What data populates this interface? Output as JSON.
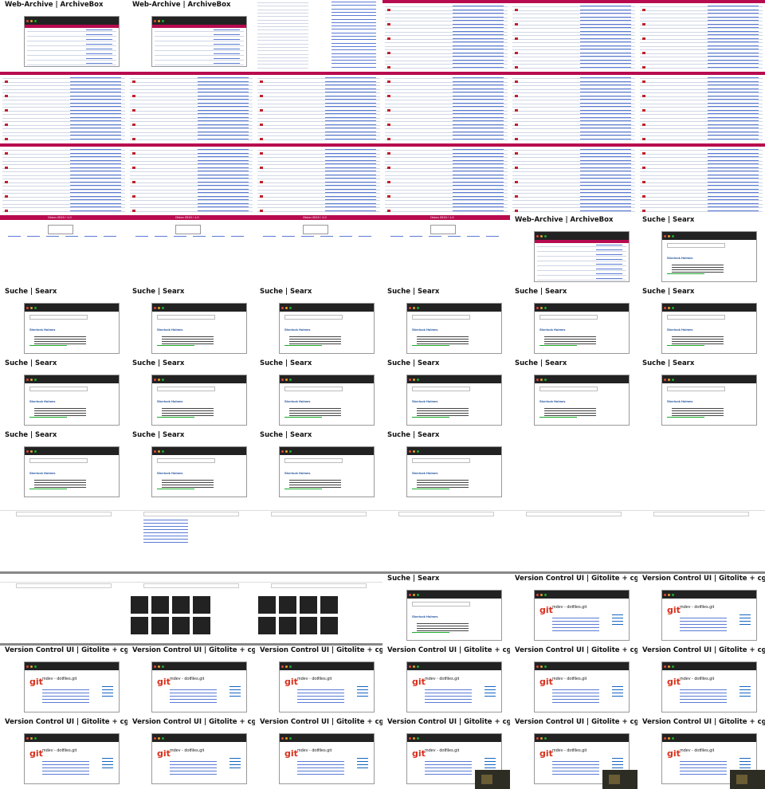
{
  "titles": {
    "archive": "Web-Archive | ArchiveBox",
    "searx": "Suche | Searx",
    "git": "Version Control UI | Gitolite + cgit"
  },
  "widgets": {
    "tor_header": "Onion 2019 / 1.0",
    "searx_heading": "Sherlock Holmes",
    "git_repo": "mdev - dotfiles.git",
    "git_logo": "git"
  },
  "tiles": [
    {
      "r": 0,
      "c": 0,
      "kind": "archive-win",
      "title": "archive"
    },
    {
      "r": 0,
      "c": 1,
      "kind": "archive-win",
      "title": "archive"
    },
    {
      "r": 0,
      "c": 2,
      "kind": "list"
    },
    {
      "r": 0,
      "c": 3,
      "kind": "table-header"
    },
    {
      "r": 0,
      "c": 4,
      "kind": "table-header"
    },
    {
      "r": 0,
      "c": 5,
      "kind": "table-header"
    },
    {
      "r": 1,
      "c": 0,
      "kind": "table-header"
    },
    {
      "r": 1,
      "c": 1,
      "kind": "table-header"
    },
    {
      "r": 1,
      "c": 2,
      "kind": "table-header"
    },
    {
      "r": 1,
      "c": 3,
      "kind": "table-header"
    },
    {
      "r": 1,
      "c": 4,
      "kind": "table-header"
    },
    {
      "r": 1,
      "c": 5,
      "kind": "table-header"
    },
    {
      "r": 2,
      "c": 0,
      "kind": "table-header"
    },
    {
      "r": 2,
      "c": 1,
      "kind": "table-header"
    },
    {
      "r": 2,
      "c": 2,
      "kind": "table-header"
    },
    {
      "r": 2,
      "c": 3,
      "kind": "table-header"
    },
    {
      "r": 2,
      "c": 4,
      "kind": "table-header"
    },
    {
      "r": 2,
      "c": 5,
      "kind": "table-header"
    },
    {
      "r": 3,
      "c": 0,
      "kind": "tor"
    },
    {
      "r": 3,
      "c": 1,
      "kind": "tor"
    },
    {
      "r": 3,
      "c": 2,
      "kind": "tor"
    },
    {
      "r": 3,
      "c": 3,
      "kind": "tor"
    },
    {
      "r": 3,
      "c": 4,
      "kind": "archive-win",
      "title": "archive"
    },
    {
      "r": 3,
      "c": 5,
      "kind": "searx-win",
      "title": "searx"
    },
    {
      "r": 4,
      "c": 0,
      "kind": "searx-win",
      "title": "searx"
    },
    {
      "r": 4,
      "c": 1,
      "kind": "searx-win",
      "title": "searx"
    },
    {
      "r": 4,
      "c": 2,
      "kind": "searx-win",
      "title": "searx"
    },
    {
      "r": 4,
      "c": 3,
      "kind": "searx-win",
      "title": "searx"
    },
    {
      "r": 4,
      "c": 4,
      "kind": "searx-win",
      "title": "searx"
    },
    {
      "r": 4,
      "c": 5,
      "kind": "searx-win",
      "title": "searx"
    },
    {
      "r": 5,
      "c": 0,
      "kind": "searx-win",
      "title": "searx"
    },
    {
      "r": 5,
      "c": 1,
      "kind": "searx-win",
      "title": "searx"
    },
    {
      "r": 5,
      "c": 2,
      "kind": "searx-win",
      "title": "searx"
    },
    {
      "r": 5,
      "c": 3,
      "kind": "searx-win",
      "title": "searx"
    },
    {
      "r": 5,
      "c": 4,
      "kind": "searx-win",
      "title": "searx"
    },
    {
      "r": 5,
      "c": 5,
      "kind": "searx-win",
      "title": "searx"
    },
    {
      "r": 6,
      "c": 0,
      "kind": "searx-win",
      "title": "searx"
    },
    {
      "r": 6,
      "c": 1,
      "kind": "searx-win",
      "title": "searx"
    },
    {
      "r": 6,
      "c": 2,
      "kind": "searx-win",
      "title": "searx"
    },
    {
      "r": 6,
      "c": 3,
      "kind": "searx-win",
      "title": "searx"
    },
    {
      "r": 6,
      "c": 4,
      "kind": "blank"
    },
    {
      "r": 6,
      "c": 5,
      "kind": "blank"
    },
    {
      "r": 7,
      "c": 0,
      "kind": "browser"
    },
    {
      "r": 7,
      "c": 1,
      "kind": "browser-list"
    },
    {
      "r": 7,
      "c": 2,
      "kind": "browser"
    },
    {
      "r": 7,
      "c": 3,
      "kind": "browser"
    },
    {
      "r": 7,
      "c": 4,
      "kind": "browser"
    },
    {
      "r": 7,
      "c": 5,
      "kind": "browser"
    },
    {
      "r": 8,
      "c": 0,
      "kind": "browser"
    },
    {
      "r": 8,
      "c": 1,
      "kind": "images"
    },
    {
      "r": 8,
      "c": 2,
      "kind": "images"
    },
    {
      "r": 8,
      "c": 3,
      "kind": "searx-win",
      "title": "searx"
    },
    {
      "r": 8,
      "c": 4,
      "kind": "git-win",
      "title": "git"
    },
    {
      "r": 8,
      "c": 5,
      "kind": "git-win",
      "title": "git"
    },
    {
      "r": 9,
      "c": 0,
      "kind": "git-win",
      "title": "git"
    },
    {
      "r": 9,
      "c": 1,
      "kind": "git-win",
      "title": "git"
    },
    {
      "r": 9,
      "c": 2,
      "kind": "git-win",
      "title": "git"
    },
    {
      "r": 9,
      "c": 3,
      "kind": "git-win",
      "title": "git"
    },
    {
      "r": 9,
      "c": 4,
      "kind": "git-win",
      "title": "git"
    },
    {
      "r": 9,
      "c": 5,
      "kind": "git-win",
      "title": "git"
    },
    {
      "r": 10,
      "c": 0,
      "kind": "git-win",
      "title": "git"
    },
    {
      "r": 10,
      "c": 1,
      "kind": "git-win",
      "title": "git"
    },
    {
      "r": 10,
      "c": 2,
      "kind": "git-win",
      "title": "git"
    },
    {
      "r": 10,
      "c": 3,
      "kind": "git-win",
      "title": "git",
      "video": true
    },
    {
      "r": 10,
      "c": 4,
      "kind": "git-win",
      "title": "git",
      "video": true
    },
    {
      "r": 10,
      "c": 5,
      "kind": "git-win",
      "title": "git",
      "video": true
    }
  ]
}
